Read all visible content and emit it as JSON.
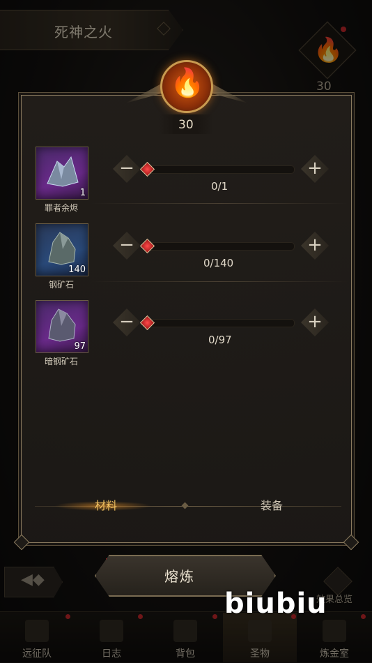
{
  "header": {
    "title": "死神之火",
    "flame_count": "30"
  },
  "modal": {
    "flame_count": "30",
    "materials": [
      {
        "name": "罪者余烬",
        "owned": "1",
        "value": "0/1",
        "frame": "purple",
        "level": 0
      },
      {
        "name": "钢矿石",
        "owned": "140",
        "value": "0/140",
        "frame": "blue",
        "level": 0
      },
      {
        "name": "暗钢矿石",
        "owned": "97",
        "value": "0/97",
        "frame": "purple",
        "level": 0
      }
    ],
    "stepper": {
      "minus": "−",
      "plus": "+"
    },
    "tabs": {
      "materials": "材料",
      "equipment": "装备",
      "active": "materials"
    }
  },
  "smelt_button": {
    "label": "熔炼"
  },
  "effects": {
    "label": "效果总览"
  },
  "nav": {
    "items": [
      {
        "label": "远征队"
      },
      {
        "label": "日志"
      },
      {
        "label": "背包"
      },
      {
        "label": "圣物"
      },
      {
        "label": "炼金室"
      }
    ],
    "active": "圣物"
  },
  "watermark": "biubiu",
  "colors": {
    "accent": "#f0c060",
    "alert": "#c8282c",
    "knob": "#d02020",
    "frame": "#8a7a5e"
  }
}
